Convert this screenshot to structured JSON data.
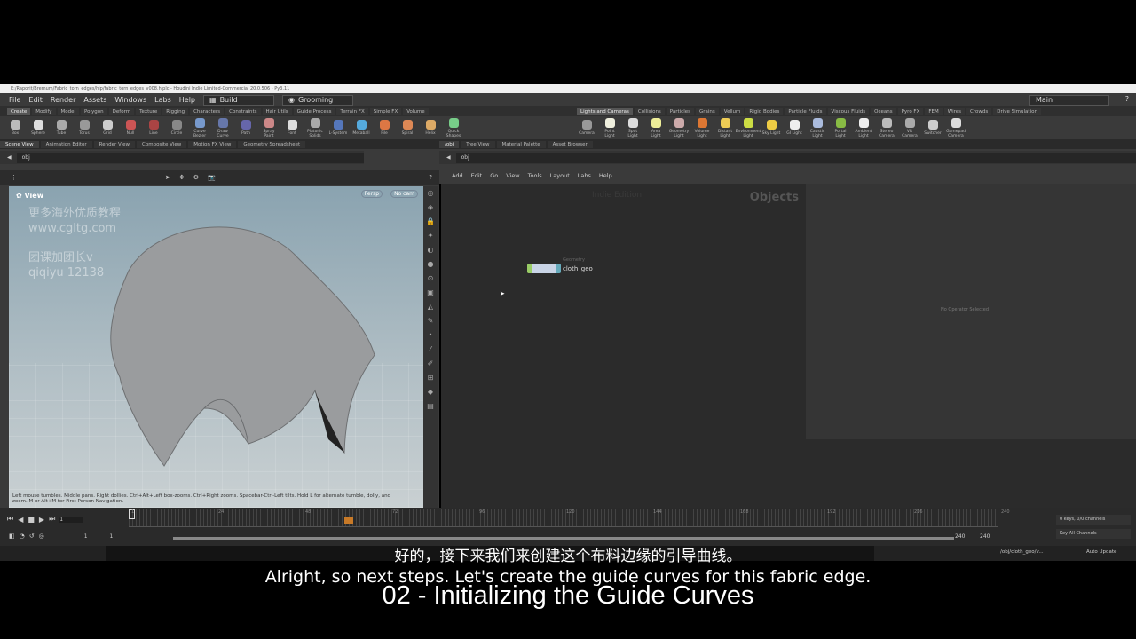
{
  "title_bar": "E:/Raporit/Bremum/Fabric_torn_edges/hip/fabric_torn_edges_v008.hiplc - Houdini Indie Limited-Commercial 20.0.506 - Py3.11",
  "menu": [
    "File",
    "Edit",
    "Render",
    "Assets",
    "Windows",
    "Labs",
    "Help"
  ],
  "desktop": "Build",
  "context": "Grooming",
  "main_desktop": "Main",
  "shelf_tabs_left": [
    "Create",
    "Modify",
    "Model",
    "Polygon",
    "Deform",
    "Texture",
    "Rigging",
    "Characters",
    "Constraints",
    "Hair Utils",
    "Guide Process",
    "Terrain FX",
    "Simple FX",
    "Volume"
  ],
  "shelf_tools_left": [
    "Box",
    "Sphere",
    "Tube",
    "Torus",
    "Grid",
    "Null",
    "Line",
    "Circle",
    "Curve Bezier",
    "Draw Curve",
    "Path",
    "Spray Paint",
    "Font",
    "Platonic Solids",
    "L-System",
    "Metaball",
    "File",
    "Spiral",
    "Helix",
    "Quick Shapes"
  ],
  "shelf_tabs_right": [
    "Lights and Cameras",
    "Collisions",
    "Particles",
    "Grains",
    "Vellum",
    "Rigid Bodies",
    "Particle Fluids",
    "Viscous Fluids",
    "Oceans",
    "Pyro FX",
    "FEM",
    "Wires",
    "Crowds",
    "Drive Simulation"
  ],
  "shelf_tools_right": [
    "Camera",
    "Point Light",
    "Spot Light",
    "Area Light",
    "Geometry Light",
    "Volume Light",
    "Distant Light",
    "Environment Light",
    "Sky Light",
    "GI Light",
    "Caustic Light",
    "Portal Light",
    "Ambient Light",
    "Stereo Camera",
    "VR Camera",
    "Switcher",
    "Gamepad Camera"
  ],
  "left_pane_tabs": [
    "Scene View",
    "Animation Editor",
    "Render View",
    "Composite View",
    "Motion FX View",
    "Geometry Spreadsheet"
  ],
  "right_pane_tabs": [
    "/obj",
    "Tree View",
    "Material Palette",
    "Asset Browser"
  ],
  "path": "obj",
  "viewport": {
    "label": "View",
    "persp": "Persp",
    "cam": "No cam",
    "watermark1": "更多海外优质教程",
    "watermark2": "www.cgltg.com",
    "watermark3": "团课加团长v",
    "watermark4": "qiqiyu 12138",
    "hint": "Left mouse tumbles. Middle pans. Right dollies. Ctrl+Alt+Left box-zooms. Ctrl+Right zooms. Spacebar-Ctrl-Left tilts. Hold L for alternate tumble, dolly, and zoom.  M or Alt+M for First Person Navigation."
  },
  "network": {
    "menu": [
      "Add",
      "Edit",
      "Go",
      "View",
      "Tools",
      "Layout",
      "Labs",
      "Help"
    ],
    "watermark": "Indie Edition",
    "context_label": "Objects",
    "node_type": "Geometry",
    "node_name": "cloth_geo",
    "params_empty": "No Operator Selected"
  },
  "timeline": {
    "ticks": [
      "1",
      "24",
      "48",
      "72",
      "96",
      "120",
      "144",
      "168",
      "192",
      "216",
      "240"
    ],
    "frame": "1",
    "start": "1",
    "start2": "1",
    "end": "240",
    "end2": "240",
    "current_fraction": 0.0,
    "keys": "0 keys, 0/0 channels",
    "key_all": "Key All Channels"
  },
  "status": {
    "path": "/obj/cloth_geo/v...",
    "auto_update": "Auto Update"
  },
  "subtitles": {
    "zh": "好的，接下来我们来创建这个布料边缘的引导曲线。",
    "en": "Alright, so next steps. Let's create the guide curves for this fabric edge.",
    "chapter": "02 - Initializing the Guide Curves"
  }
}
